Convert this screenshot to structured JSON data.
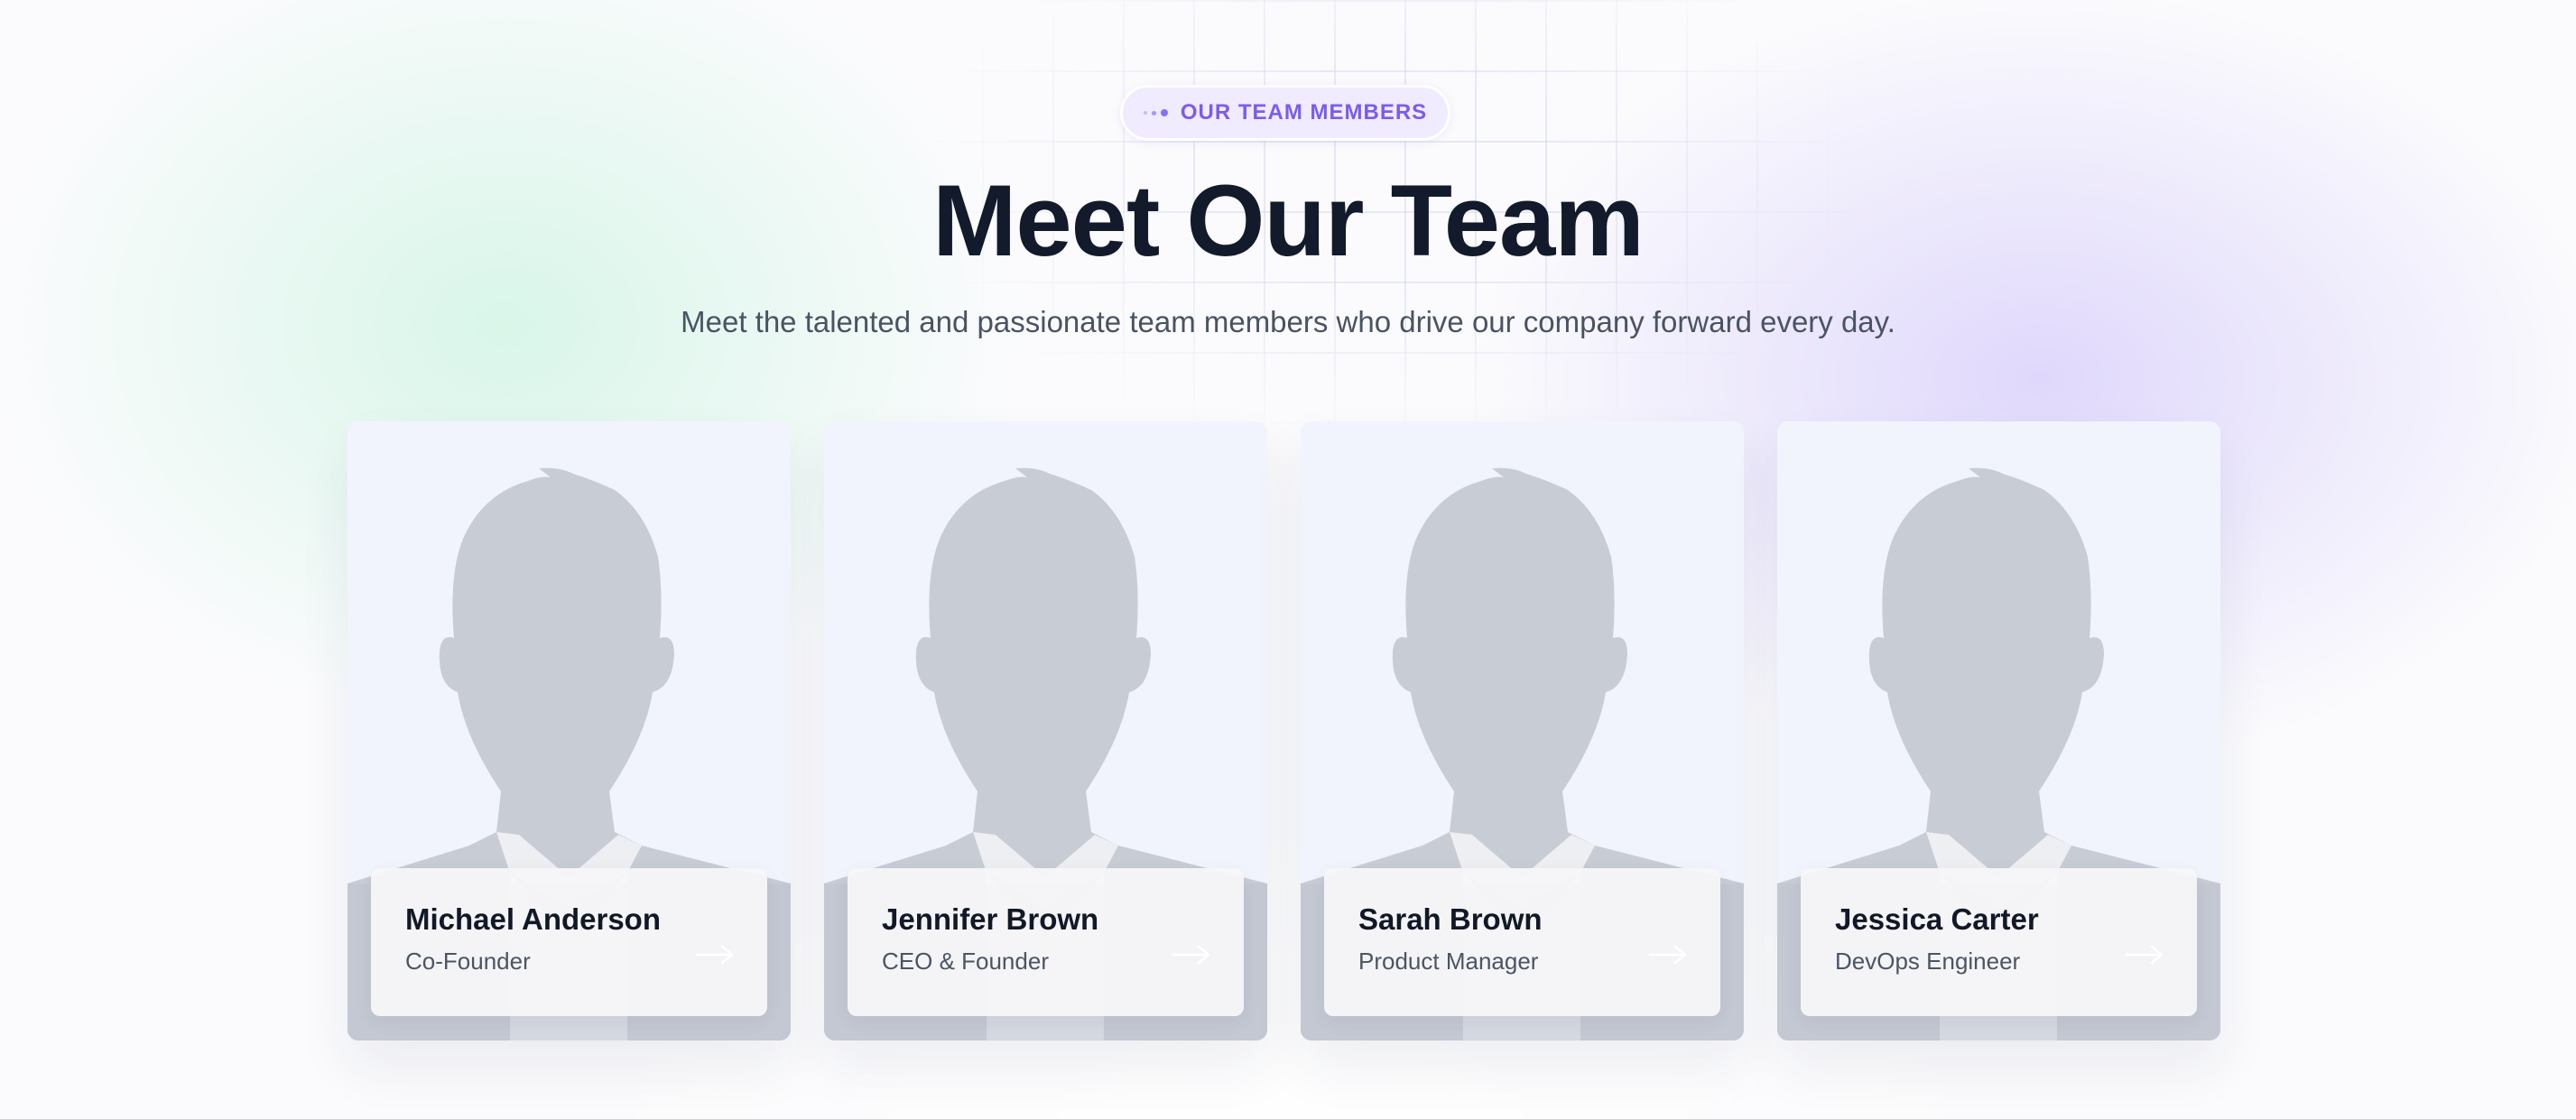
{
  "section": {
    "badge": {
      "label": "OUR TEAM MEMBERS",
      "icon": "dots-icon",
      "color": "#7c5ce8"
    },
    "title": "Meet Our Team",
    "subtitle": "Meet the talented and passionate team members who drive our company forward every day."
  },
  "team": [
    {
      "name": "Michael Anderson",
      "role": "Co-Founder",
      "photo_icon": "avatar-silhouette",
      "link_icon": "arrow-right-icon"
    },
    {
      "name": "Jennifer Brown",
      "role": "CEO & Founder",
      "photo_icon": "avatar-silhouette",
      "link_icon": "arrow-right-icon"
    },
    {
      "name": "Sarah Brown",
      "role": "Product Manager",
      "photo_icon": "avatar-silhouette",
      "link_icon": "arrow-right-icon"
    },
    {
      "name": "Jessica Carter",
      "role": "DevOps Engineer",
      "photo_icon": "avatar-silhouette",
      "link_icon": "arrow-right-icon"
    }
  ],
  "colors": {
    "accent": "#7c5ce8",
    "heading": "#121a2b",
    "body_text": "#4a5363",
    "photo_bg": "#f1f4fd",
    "silhouette": "#c8ccd5"
  }
}
